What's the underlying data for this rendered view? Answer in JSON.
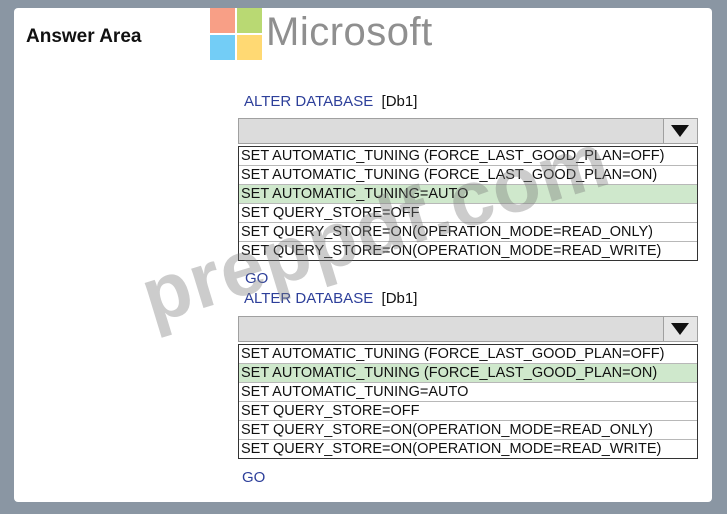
{
  "header": {
    "answer_area": "Answer Area",
    "brand": "Microsoft"
  },
  "colors": {
    "ms_red": "#f25022",
    "ms_green": "#7fba00",
    "ms_blue": "#00a4ef",
    "ms_yellow": "#ffb900",
    "selected_bg": "#cfe8cc",
    "keyword": "#2d3f9a"
  },
  "blocks": [
    {
      "statement": "ALTER DATABASE",
      "db": "[Db1]",
      "selected": "",
      "options": [
        "SET AUTOMATIC_TUNING (FORCE_LAST_GOOD_PLAN=OFF)",
        "SET AUTOMATIC_TUNING (FORCE_LAST_GOOD_PLAN=ON)",
        "SET AUTOMATIC_TUNING=AUTO",
        "SET QUERY_STORE=OFF",
        "SET QUERY_STORE=ON(OPERATION_MODE=READ_ONLY)",
        "SET QUERY_STORE=ON(OPERATION_MODE=READ_WRITE)"
      ],
      "highlighted_index": 2,
      "go": "GO"
    },
    {
      "statement": "ALTER DATABASE",
      "db": "[Db1]",
      "selected": "",
      "options": [
        "SET AUTOMATIC_TUNING (FORCE_LAST_GOOD_PLAN=OFF)",
        "SET AUTOMATIC_TUNING (FORCE_LAST_GOOD_PLAN=ON)",
        "SET AUTOMATIC_TUNING=AUTO",
        "SET QUERY_STORE=OFF",
        "SET QUERY_STORE=ON(OPERATION_MODE=READ_ONLY)",
        "SET QUERY_STORE=ON(OPERATION_MODE=READ_WRITE)"
      ],
      "highlighted_index": 1,
      "go": "GO"
    }
  ],
  "watermark": "preppdf.com"
}
